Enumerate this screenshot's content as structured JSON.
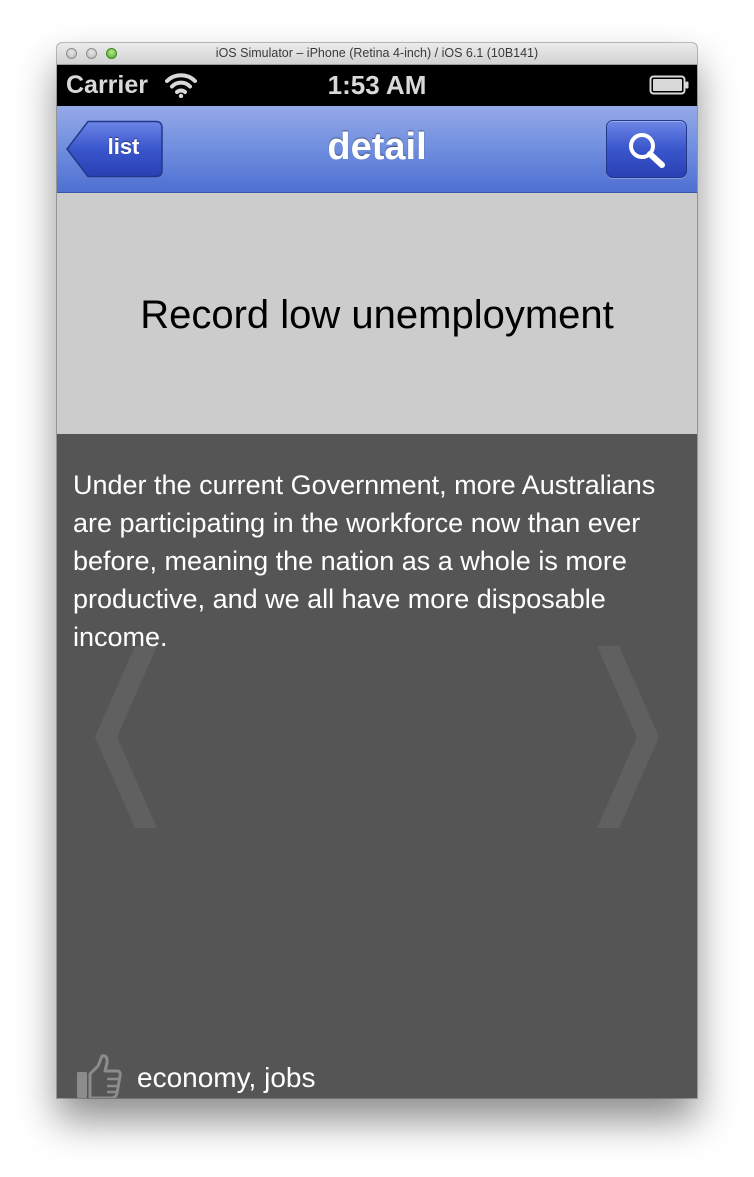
{
  "window": {
    "title": "iOS Simulator – iPhone (Retina 4-inch) / iOS 6.1 (10B141)"
  },
  "statusbar": {
    "carrier": "Carrier",
    "time": "1:53 AM",
    "wifi_icon": "wifi-icon",
    "battery_icon": "battery-icon"
  },
  "navbar": {
    "title": "detail",
    "back_label": "list",
    "search_icon": "search-icon",
    "tint": "#5a78d8"
  },
  "header": {
    "headline": "Record low unemployment"
  },
  "content": {
    "body": "Under the current Government, more Australians are participating in the workforce now than ever before, meaning the nation as a whole is more productive, and we all have more disposable income.",
    "prev_icon": "chevron-left-icon",
    "next_icon": "chevron-right-icon"
  },
  "footer": {
    "like_icon": "thumbs-up-icon",
    "tags": "economy, jobs"
  }
}
